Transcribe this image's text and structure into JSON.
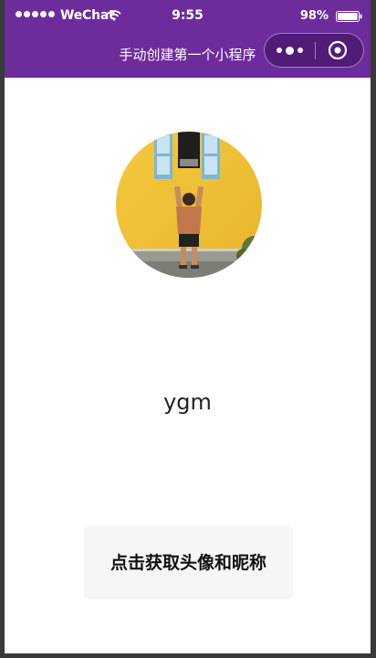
{
  "status_bar": {
    "carrier": "WeChat",
    "time": "9:55",
    "battery": "98%",
    "battery_level": 0.98,
    "signal_bars": 5
  },
  "nav": {
    "title": "手动创建第一个小程序",
    "more_icon": "more-dots-icon",
    "close_icon": "target-close-icon"
  },
  "profile": {
    "avatar_icon": "avatar-photo",
    "nickname": "ygm"
  },
  "auth_button": {
    "label": "点击获取头像和昵称"
  },
  "colors": {
    "nav_background": "#6d2c9b",
    "page_background": "#ffffff",
    "button_background": "#f6f6f6"
  }
}
